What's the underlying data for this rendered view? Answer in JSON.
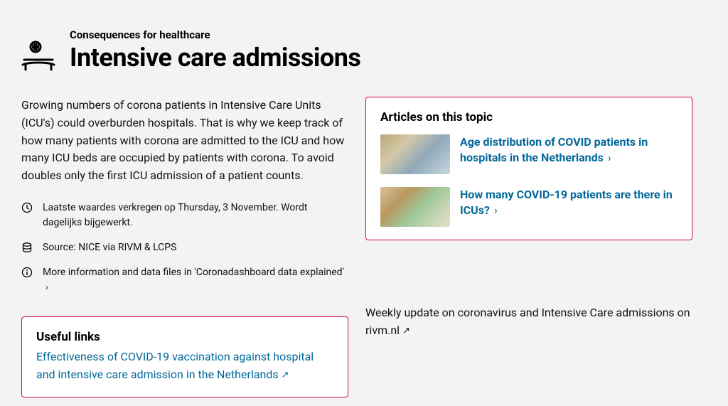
{
  "header": {
    "category": "Consequences for healthcare",
    "title": "Intensive care admissions"
  },
  "intro": "Growing numbers of corona patients in Intensive Care Units (ICU's) could overburden hospitals. That is why we keep track of how many patients with corona are admitted to the ICU and how many ICU beds are occupied by patients with corona. To avoid doubles only the first ICU admission of a patient counts.",
  "meta": {
    "updated": "Laatste waardes verkregen op Thursday, 3 November. Wordt dagelijks bijgewerkt.",
    "source": "Source: NICE via RIVM & LCPS",
    "more_info": "More information and data files in 'Coronadashboard data explained'"
  },
  "useful_links": {
    "title": "Useful links",
    "items": [
      "Effectiveness of COVID-19 vaccination against hospital and intensive care admission in the Netherlands"
    ]
  },
  "articles": {
    "title": "Articles on this topic",
    "items": [
      "Age distribution of COVID patients in hospitals in the Netherlands",
      "How many COVID-19 patients are there in ICUs?"
    ]
  },
  "weekly_update": "Weekly update on coronavirus and Intensive Care admissions on rivm.nl"
}
